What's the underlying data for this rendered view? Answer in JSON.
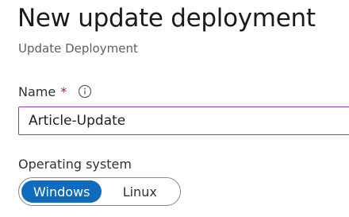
{
  "header": {
    "title": "New update deployment",
    "subtitle": "Update Deployment"
  },
  "form": {
    "name": {
      "label": "Name",
      "required_marker": "*",
      "info_icon": "info-icon",
      "value": "Article-Update"
    },
    "operating_system": {
      "label": "Operating system",
      "options": [
        "Windows",
        "Linux"
      ],
      "selected": "Windows"
    }
  },
  "colors": {
    "accent": "#0f6cbd",
    "input_focus_border": "#8a3ea8",
    "required": "#a4262c"
  }
}
